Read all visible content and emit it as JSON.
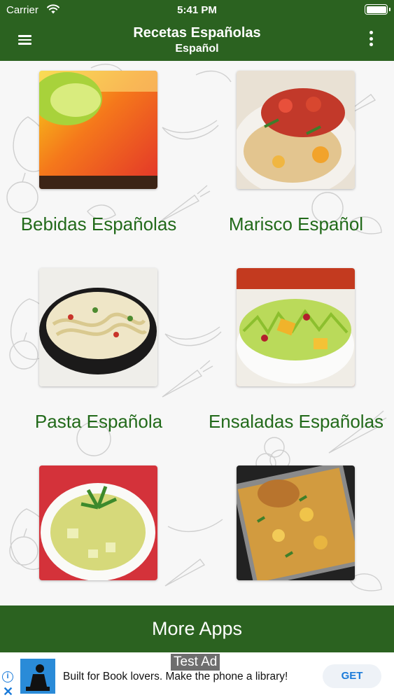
{
  "status_bar": {
    "carrier": "Carrier",
    "time": "5:41 PM"
  },
  "nav": {
    "title": "Recetas Españolas",
    "subtitle": "Español"
  },
  "categories": [
    {
      "label": "Bebidas Españolas"
    },
    {
      "label": "Marisco Español"
    },
    {
      "label": "Pasta Española"
    },
    {
      "label": "Ensaladas Españolas"
    },
    {
      "label": ""
    },
    {
      "label": ""
    }
  ],
  "more_apps": "More Apps",
  "ad": {
    "badge": "Test Ad",
    "text": "Built for Book lovers. Make the phone a library!",
    "cta": "GET",
    "info": "i",
    "close": "✕"
  },
  "colors": {
    "brand_green": "#2b6220",
    "label_green": "#226a1a",
    "ad_blue": "#1a7ad9"
  }
}
